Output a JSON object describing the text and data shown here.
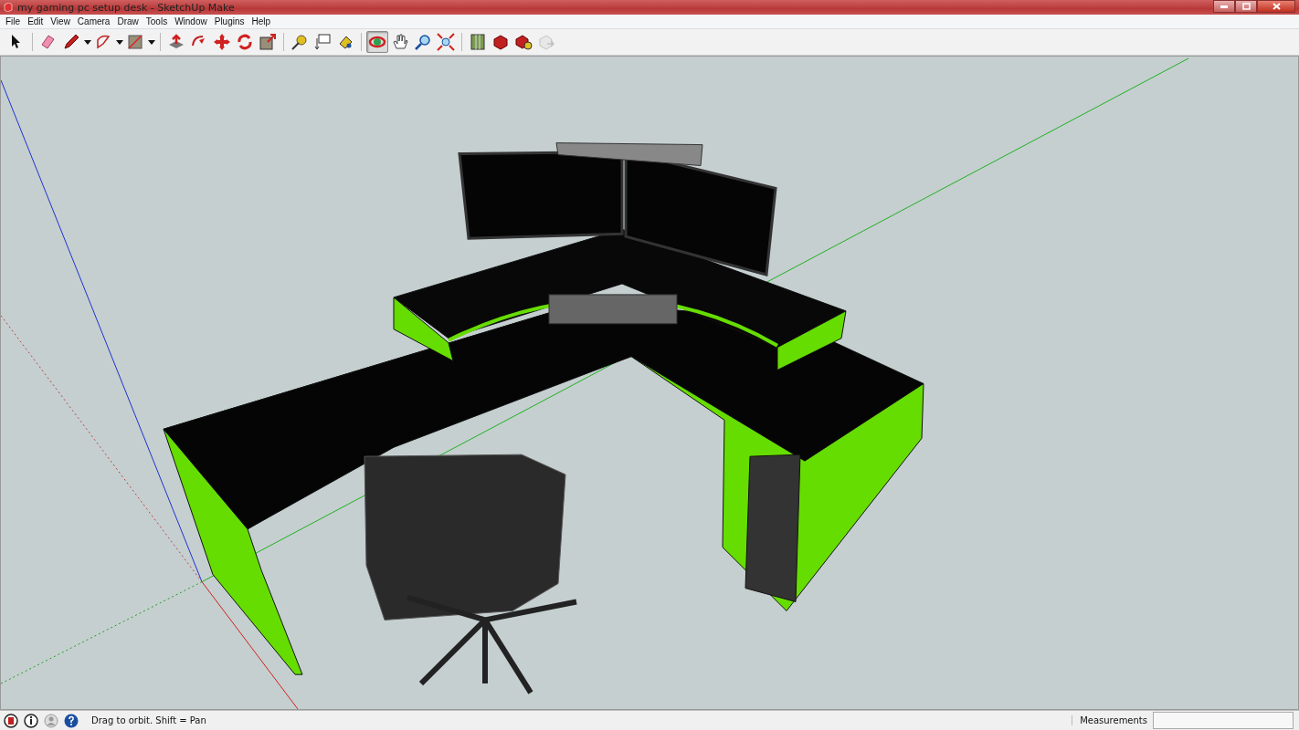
{
  "window": {
    "title": "my gaming pc setup desk - SketchUp Make"
  },
  "menu": [
    "File",
    "Edit",
    "View",
    "Camera",
    "Draw",
    "Tools",
    "Window",
    "Plugins",
    "Help"
  ],
  "toolbar": [
    {
      "selected": false
    },
    {
      "selected": false
    },
    {
      "selected": false
    },
    {
      "selected": false
    },
    {
      "selected": false
    },
    {
      "selected": false
    },
    {
      "selected": false
    },
    {
      "selected": false
    },
    {
      "selected": false
    },
    {
      "selected": false
    },
    {
      "selected": false
    },
    {
      "selected": false
    },
    {
      "selected": false
    },
    {
      "selected": true
    },
    {
      "selected": false
    },
    {
      "selected": false
    },
    {
      "selected": false
    },
    {
      "selected": false
    },
    {
      "selected": false
    },
    {
      "selected": false
    },
    {
      "selected": false,
      "disabled": true
    }
  ],
  "status_bar": {
    "hint": "Drag to orbit.  Shift = Pan",
    "measurements_label": "Measurements"
  }
}
